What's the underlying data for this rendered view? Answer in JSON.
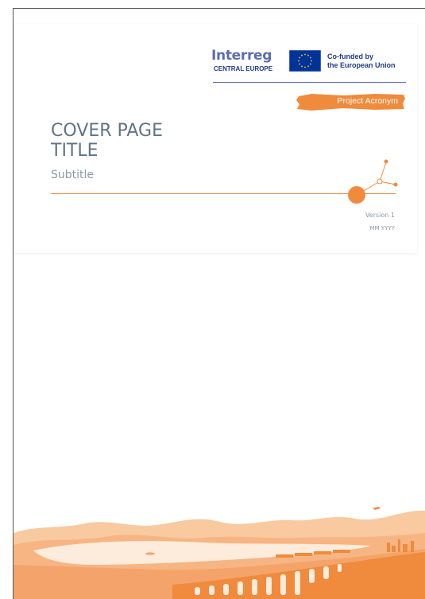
{
  "logo": {
    "wordmark": "Interreg",
    "program": "CENTRAL EUROPE",
    "eu_line1": "Co-funded by",
    "eu_line2": "the European Union"
  },
  "acronym": "Project Acronym",
  "title_line1": "COVER PAGE",
  "title_line2": "TITLE",
  "subtitle": "Subtitle",
  "version": "Version 1",
  "date": "MM YYYY",
  "colors": {
    "accent": "#f08a3c",
    "brand_blue": "#1f3a8a",
    "title_gray": "#5f7486",
    "eu_flag": "#003399",
    "eu_star": "#ffcc00"
  },
  "icons": [
    "eu-flag-icon",
    "network-node-icon",
    "landscape-illustration"
  ]
}
